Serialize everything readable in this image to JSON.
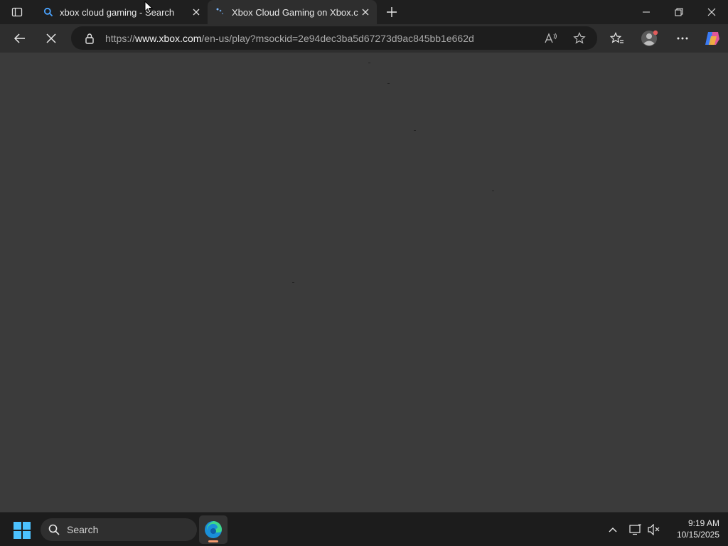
{
  "tabs": [
    {
      "title": "xbox cloud gaming - Search",
      "icon": "search-icon",
      "active": false
    },
    {
      "title": "Xbox Cloud Gaming on Xbox.com",
      "icon": "loading-icon",
      "active": true
    }
  ],
  "address_bar": {
    "url_prefix": "https://",
    "url_domain": "www.xbox.com",
    "url_path": "/en-us/play?msockid=2e94dec3ba5d67273d9ac845bb1e662d"
  },
  "taskbar": {
    "search_placeholder": "Search",
    "time": "9:19 AM",
    "date": "10/15/2025"
  },
  "colors": {
    "page_background": "#3b3b3b",
    "tabstrip": "#1f1f1f",
    "toolbar": "#2e2e2e",
    "address": "#1d1d1d",
    "taskbar": "#1c1c1c"
  }
}
